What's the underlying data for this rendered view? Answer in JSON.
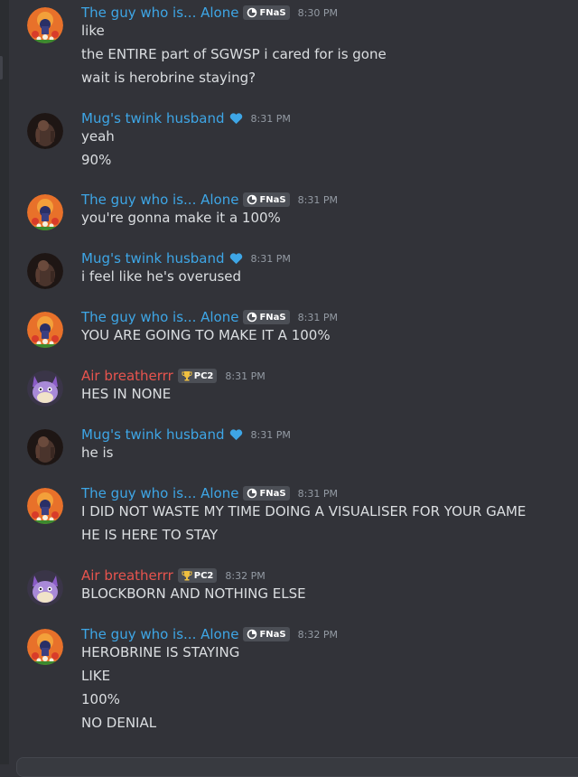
{
  "colors": {
    "background": "#323339",
    "author_blue": "#3ea6e6",
    "author_red": "#e8544e",
    "heart": "#3ea6e6",
    "timestamp": "#949ba4",
    "text": "#dbdee1"
  },
  "messages": [
    {
      "author": "The guy who is... Alone",
      "author_color": "blue",
      "avatar": "orange-creature-avatar",
      "tag": {
        "icon": "ring-icon",
        "label": "FNaS"
      },
      "time": "8:30 PM",
      "lines": [
        "like",
        "the ENTIRE part of SGWSP i cared for is gone",
        "wait is herobrine staying?"
      ]
    },
    {
      "author": "Mug's twink husband",
      "author_color": "blue",
      "avatar": "dark-figure-avatar",
      "heart": true,
      "time": "8:31 PM",
      "lines": [
        "yeah",
        "90%"
      ]
    },
    {
      "author": "The guy who is... Alone",
      "author_color": "blue",
      "avatar": "orange-creature-avatar",
      "tag": {
        "icon": "ring-icon",
        "label": "FNaS"
      },
      "time": "8:31 PM",
      "lines": [
        "you're gonna make it a 100%"
      ]
    },
    {
      "author": "Mug's twink husband",
      "author_color": "blue",
      "avatar": "dark-figure-avatar",
      "heart": true,
      "time": "8:31 PM",
      "lines": [
        "i feel like he's overused"
      ]
    },
    {
      "author": "The guy who is... Alone",
      "author_color": "blue",
      "avatar": "orange-creature-avatar",
      "tag": {
        "icon": "ring-icon",
        "label": "FNaS"
      },
      "time": "8:31 PM",
      "lines": [
        "YOU ARE GOING TO MAKE IT A 100%"
      ]
    },
    {
      "author": "Air breatherrr",
      "author_color": "red",
      "avatar": "purple-cat-avatar",
      "tag": {
        "icon": "trophy-icon",
        "label": "PC2"
      },
      "time": "8:31 PM",
      "lines": [
        "HES IN NONE"
      ]
    },
    {
      "author": "Mug's twink husband",
      "author_color": "blue",
      "avatar": "dark-figure-avatar",
      "heart": true,
      "time": "8:31 PM",
      "lines": [
        "he is"
      ]
    },
    {
      "author": "The guy who is... Alone",
      "author_color": "blue",
      "avatar": "orange-creature-avatar",
      "tag": {
        "icon": "ring-icon",
        "label": "FNaS"
      },
      "time": "8:31 PM",
      "lines": [
        "I DID NOT WASTE MY TIME DOING A VISUALISER FOR YOUR GAME",
        "HE IS HERE TO STAY"
      ]
    },
    {
      "author": "Air breatherrr",
      "author_color": "red",
      "avatar": "purple-cat-avatar",
      "tag": {
        "icon": "trophy-icon",
        "label": "PC2"
      },
      "time": "8:32 PM",
      "lines": [
        "BLOCKBORN AND NOTHING ELSE"
      ]
    },
    {
      "author": "The guy who is... Alone",
      "author_color": "blue",
      "avatar": "orange-creature-avatar",
      "tag": {
        "icon": "ring-icon",
        "label": "FNaS"
      },
      "time": "8:32 PM",
      "lines": [
        "HEROBRINE IS STAYING",
        "LIKE",
        "100%",
        "NO DENIAL"
      ]
    }
  ]
}
